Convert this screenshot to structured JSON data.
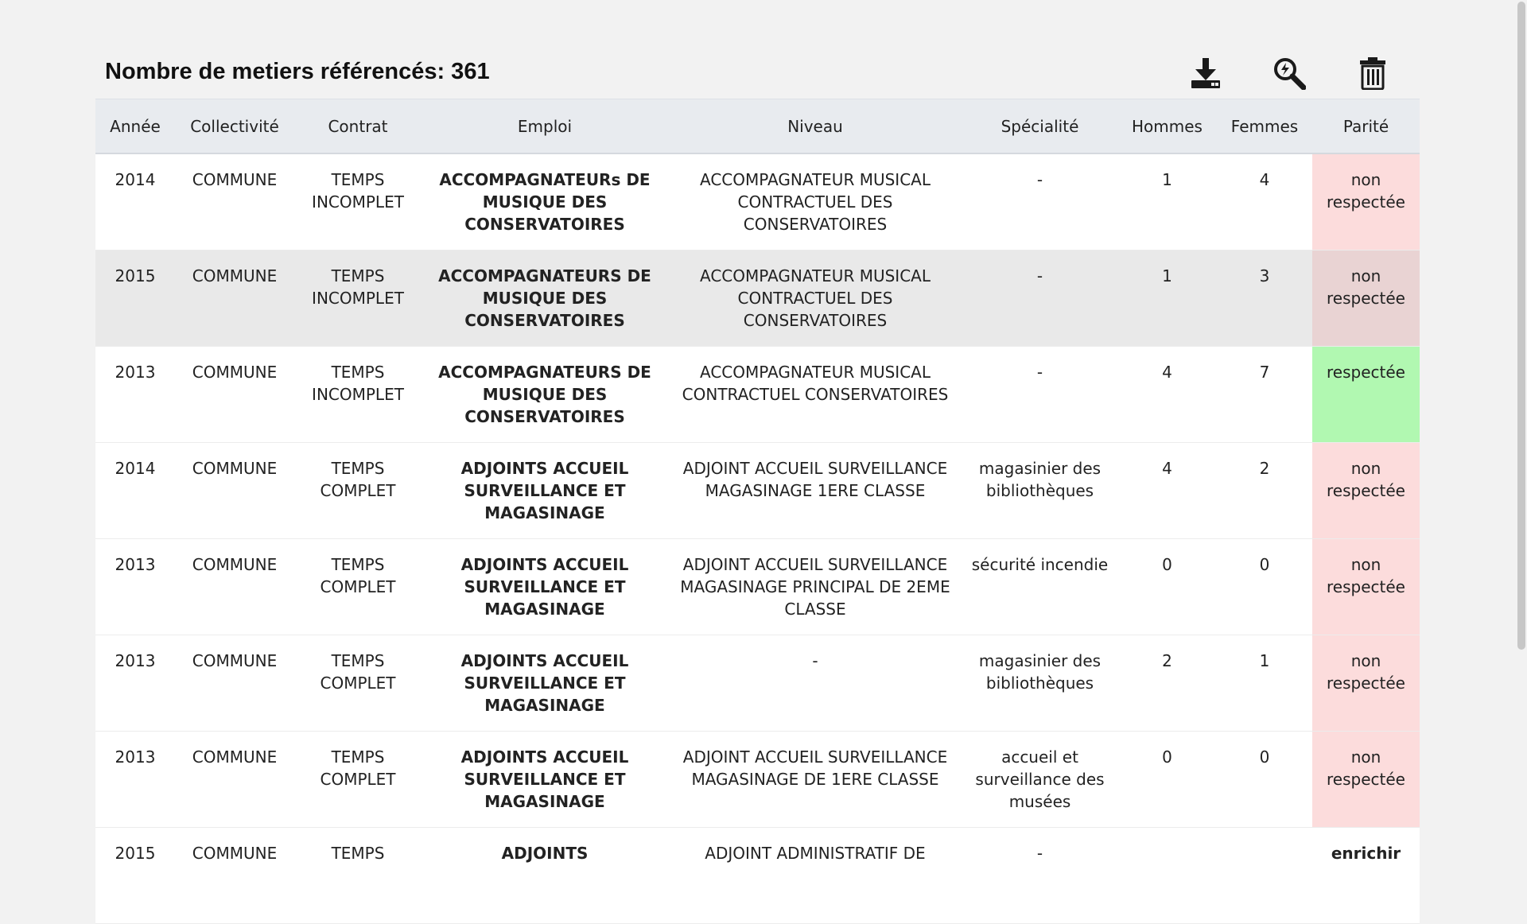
{
  "header": {
    "title": "Nombre de metiers référencés: 361"
  },
  "toolbar": {
    "download_icon": "download-icon",
    "search_icon": "search-icon",
    "delete_icon": "trash-icon"
  },
  "table": {
    "columns": [
      "Année",
      "Collectivité",
      "Contrat",
      "Emploi",
      "Niveau",
      "Spécialité",
      "Hommes",
      "Femmes",
      "Parité"
    ],
    "rows": [
      {
        "annee": "2014",
        "collectivite": "COMMUNE",
        "contrat": "TEMPS INCOMPLET",
        "emploi": "ACCOMPAGNATEURs DE MUSIQUE DES CONSERVATOIRES",
        "niveau": "ACCOMPAGNATEUR MUSICAL CONTRACTUEL DES CONSERVATOIRES",
        "specialite": "-",
        "hommes": "1",
        "femmes": "4",
        "parite": "non respectée",
        "status": "non"
      },
      {
        "annee": "2015",
        "collectivite": "COMMUNE",
        "contrat": "TEMPS INCOMPLET",
        "emploi": "ACCOMPAGNATEURS DE MUSIQUE DES CONSERVATOIRES",
        "niveau": "ACCOMPAGNATEUR MUSICAL CONTRACTUEL DES CONSERVATOIRES",
        "specialite": "-",
        "hommes": "1",
        "femmes": "3",
        "parite": "non respectée",
        "status": "non",
        "hover": true
      },
      {
        "annee": "2013",
        "collectivite": "COMMUNE",
        "contrat": "TEMPS INCOMPLET",
        "emploi": "ACCOMPAGNATEURS DE MUSIQUE DES CONSERVATOIRES",
        "niveau": "ACCOMPAGNATEUR MUSICAL CONTRACTUEL CONSERVATOIRES",
        "specialite": "-",
        "hommes": "4",
        "femmes": "7",
        "parite": "respectée",
        "status": "oui"
      },
      {
        "annee": "2014",
        "collectivite": "COMMUNE",
        "contrat": "TEMPS COMPLET",
        "emploi": "ADJOINTS ACCUEIL SURVEILLANCE ET MAGASINAGE",
        "niveau": "ADJOINT ACCUEIL SURVEILLANCE MAGASINAGE 1ERE CLASSE",
        "specialite": "magasinier des bibliothèques",
        "hommes": "4",
        "femmes": "2",
        "parite": "non respectée",
        "status": "non"
      },
      {
        "annee": "2013",
        "collectivite": "COMMUNE",
        "contrat": "TEMPS COMPLET",
        "emploi": "ADJOINTS ACCUEIL SURVEILLANCE ET MAGASINAGE",
        "niveau": "ADJOINT ACCUEIL SURVEILLANCE MAGASINAGE PRINCIPAL DE 2EME CLASSE",
        "specialite": "sécurité incendie",
        "hommes": "0",
        "femmes": "0",
        "parite": "non respectée",
        "status": "non"
      },
      {
        "annee": "2013",
        "collectivite": "COMMUNE",
        "contrat": "TEMPS COMPLET",
        "emploi": "ADJOINTS ACCUEIL SURVEILLANCE ET MAGASINAGE",
        "niveau": "-",
        "specialite": "magasinier des bibliothèques",
        "hommes": "2",
        "femmes": "1",
        "parite": "non respectée",
        "status": "non"
      },
      {
        "annee": "2013",
        "collectivite": "COMMUNE",
        "contrat": "TEMPS COMPLET",
        "emploi": "ADJOINTS ACCUEIL SURVEILLANCE ET MAGASINAGE",
        "niveau": "ADJOINT ACCUEIL SURVEILLANCE MAGASINAGE DE 1ERE CLASSE",
        "specialite": "accueil et surveillance des musées",
        "hommes": "0",
        "femmes": "0",
        "parite": "non respectée",
        "status": "non"
      },
      {
        "annee": "2015",
        "collectivite": "COMMUNE",
        "contrat": "TEMPS",
        "emploi": "ADJOINTS",
        "niveau": "ADJOINT ADMINISTRATIF DE",
        "specialite": "-",
        "hommes": "",
        "femmes": "",
        "parite": "enrichir",
        "status": "enrichir"
      }
    ]
  },
  "colors": {
    "parite_non": "#fcdcdc",
    "parite_oui": "#b1f8b1",
    "header_bg": "#e8ebef",
    "page_bg": "#f2f2f2"
  }
}
